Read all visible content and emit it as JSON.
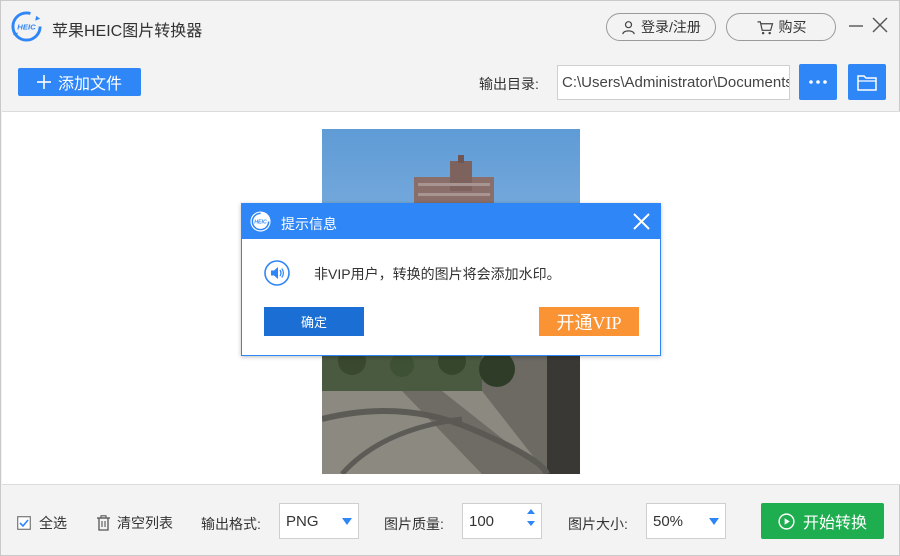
{
  "app": {
    "logo_text": "HEIC",
    "title": "苹果HEIC图片转换器",
    "login_label": "登录/注册",
    "buy_label": "购买"
  },
  "toolbar": {
    "add_file_label": "添加文件",
    "output_dir_label": "输出目录:",
    "output_dir_value": "C:\\Users\\Administrator\\Documents"
  },
  "bottom": {
    "select_all_label": "全选",
    "select_all_checked": true,
    "clear_list_label": "清空列表",
    "format_label": "输出格式:",
    "format_value": "PNG",
    "quality_label": "图片质量:",
    "quality_value": "100",
    "size_label": "图片大小:",
    "size_value": "50%",
    "start_label": "开始转换"
  },
  "dialog": {
    "logo_text": "HEIC",
    "title": "提示信息",
    "message": "非VIP用户，转换的图片将会添加水印。",
    "confirm_label": "确定",
    "vip_label": "开通VIP"
  },
  "colors": {
    "accent": "#2f86f6",
    "confirm": "#1b6ed3",
    "vip": "#f99334",
    "start": "#1fae4f"
  },
  "icons": {
    "logo": "heic-logo-icon",
    "user": "user-icon",
    "cart": "cart-icon",
    "minimize": "minimize-icon",
    "close": "close-icon",
    "plus": "plus-icon",
    "more": "ellipsis-icon",
    "folder": "folder-icon",
    "checkbox": "checkbox-icon",
    "trash": "trash-icon",
    "play": "play-circle-icon",
    "speaker": "speaker-icon"
  }
}
